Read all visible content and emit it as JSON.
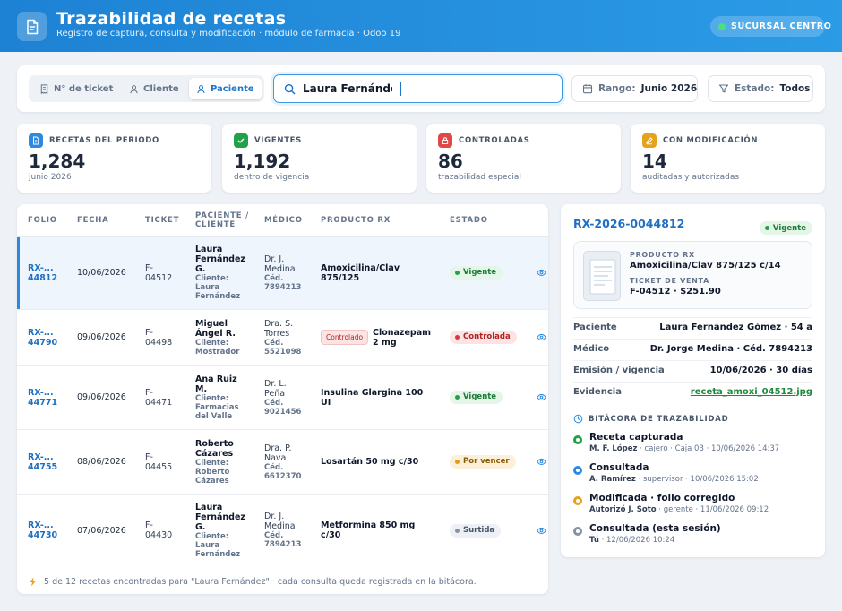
{
  "header": {
    "title": "Trazabilidad de recetas",
    "subtitle": "Registro de captura, consulta y modificación · módulo de farmacia · Odoo 19",
    "branch": "SUCURSAL CENTRO"
  },
  "search": {
    "modes": [
      "N° de ticket",
      "Cliente",
      "Paciente"
    ],
    "active_mode": "Paciente",
    "value": "Laura Fernández",
    "range_label": "Rango:",
    "range_value": "Junio 2026",
    "status_label": "Estado:",
    "status_value": "Todos"
  },
  "stats": [
    {
      "label": "RECETAS DEL PERIODO",
      "value": "1,284",
      "sub": "junio 2026",
      "icon": "document-icon",
      "color": "#2b8ae0"
    },
    {
      "label": "VIGENTES",
      "value": "1,192",
      "sub": "dentro de vigencia",
      "icon": "check-icon",
      "color": "#22a04a"
    },
    {
      "label": "CONTROLADAS",
      "value": "86",
      "sub": "trazabilidad especial",
      "icon": "lock-icon",
      "color": "#e04848"
    },
    {
      "label": "CON MODIFICACIÓN",
      "value": "14",
      "sub": "auditadas y autorizadas",
      "icon": "edit-icon",
      "color": "#e5a21a"
    }
  ],
  "table": {
    "columns": [
      "FOLIO",
      "FECHA",
      "TICKET",
      "PACIENTE / CLIENTE",
      "MÉDICO",
      "PRODUCTO RX",
      "ESTADO"
    ],
    "rows": [
      {
        "folio": "RX-...",
        "folio2": "44812",
        "date": "10/06/2026",
        "ticket1": "F-",
        "ticket2": "04512",
        "patient": [
          "Laura",
          "Fernández",
          "G."
        ],
        "client": [
          "Cliente:",
          "Laura",
          "Fernández"
        ],
        "doctor": [
          "Dr. J.",
          "Medina"
        ],
        "ced": [
          "Céd.",
          "7894213"
        ],
        "product": [
          "Amoxicilina/Clav",
          "875/125"
        ],
        "tag": "",
        "status": "Vigente",
        "status_color": "green"
      },
      {
        "folio": "RX-...",
        "folio2": "44790",
        "date": "09/06/2026",
        "ticket1": "F-",
        "ticket2": "04498",
        "patient": [
          "Miguel",
          "Ángel R."
        ],
        "client": [
          "Cliente:",
          "Mostrador"
        ],
        "doctor": [
          "Dra. S.",
          "Torres"
        ],
        "ced": [
          "Céd.",
          "5521098"
        ],
        "product": [
          "Clonazepam",
          "2 mg"
        ],
        "tag": "Controlado",
        "status": "Controlada",
        "status_color": "red"
      },
      {
        "folio": "RX-...",
        "folio2": "44771",
        "date": "09/06/2026",
        "ticket1": "F-",
        "ticket2": "04471",
        "patient": [
          "Ana Ruiz",
          "M."
        ],
        "client": [
          "Cliente:",
          "Farmacias",
          "del Valle"
        ],
        "doctor": [
          "Dr. L.",
          "Peña"
        ],
        "ced": [
          "Céd.",
          "9021456"
        ],
        "product": [
          "Insulina Glargina 100",
          "UI"
        ],
        "tag": "",
        "status": "Vigente",
        "status_color": "green"
      },
      {
        "folio": "RX-...",
        "folio2": "44755",
        "date": "08/06/2026",
        "ticket1": "F-",
        "ticket2": "04455",
        "patient": [
          "Roberto",
          "Cázares"
        ],
        "client": [
          "Cliente:",
          "Roberto",
          "Cázares"
        ],
        "doctor": [
          "Dra. P.",
          "Nava"
        ],
        "ced": [
          "Céd.",
          "6612370"
        ],
        "product": [
          "Losartán 50 mg c/30"
        ],
        "tag": "",
        "status": "Por vencer",
        "status_color": "amber"
      },
      {
        "folio": "RX-...",
        "folio2": "44730",
        "date": "07/06/2026",
        "ticket1": "F-",
        "ticket2": "04430",
        "patient": [
          "Laura",
          "Fernández",
          "G."
        ],
        "client": [
          "Cliente:",
          "Laura",
          "Fernández"
        ],
        "doctor": [
          "Dr. J.",
          "Medina"
        ],
        "ced": [
          "Céd.",
          "7894213"
        ],
        "product": [
          "Metformina 850 mg",
          "c/30"
        ],
        "tag": "",
        "status": "Surtida",
        "status_color": "gray"
      }
    ],
    "footer": "5 de 12 recetas encontradas para \"Laura Fernández\" · cada consulta queda registrada en la bitácora."
  },
  "detail": {
    "folio": "RX-2026-0044812",
    "status": "Vigente",
    "product_label": "PRODUCTO RX",
    "product": "Amoxicilina/Clav 875/125 c/14",
    "ticket_label": "TICKET DE VENTA",
    "ticket": "F-04512 · $251.90",
    "fields": [
      {
        "k": "Paciente",
        "v": "Laura Fernández Gómez · 54 a"
      },
      {
        "k": "Médico",
        "v": "Dr. Jorge Medina · Céd. 7894213"
      },
      {
        "k": "Emisión / vigencia",
        "v": "10/06/2026 · 30 días"
      },
      {
        "k": "Evidencia",
        "v": "receta_amoxi_04512.jpg"
      }
    ],
    "log_title": "BITÁCORA DE TRAZABILIDAD",
    "log": [
      {
        "title": "Receta capturada",
        "who": "M. F. López",
        "rest": " · cajero · Caja 03 · 10/06/2026 14:37",
        "color": "#22a04a"
      },
      {
        "title": "Consultada",
        "who": "A. Ramírez",
        "rest": " · supervisor · 10/06/2026 15:02",
        "color": "#2b8ae0"
      },
      {
        "title": "Modificada · folio corregido",
        "who": "Autorizó J. Soto",
        "rest": " · gerente · 11/06/2026 09:12",
        "color": "#e5a21a"
      },
      {
        "title": "Consultada (esta sesión)",
        "who": "Tú",
        "rest": " · 12/06/2026 10:24",
        "color": "#8592a3"
      }
    ]
  }
}
